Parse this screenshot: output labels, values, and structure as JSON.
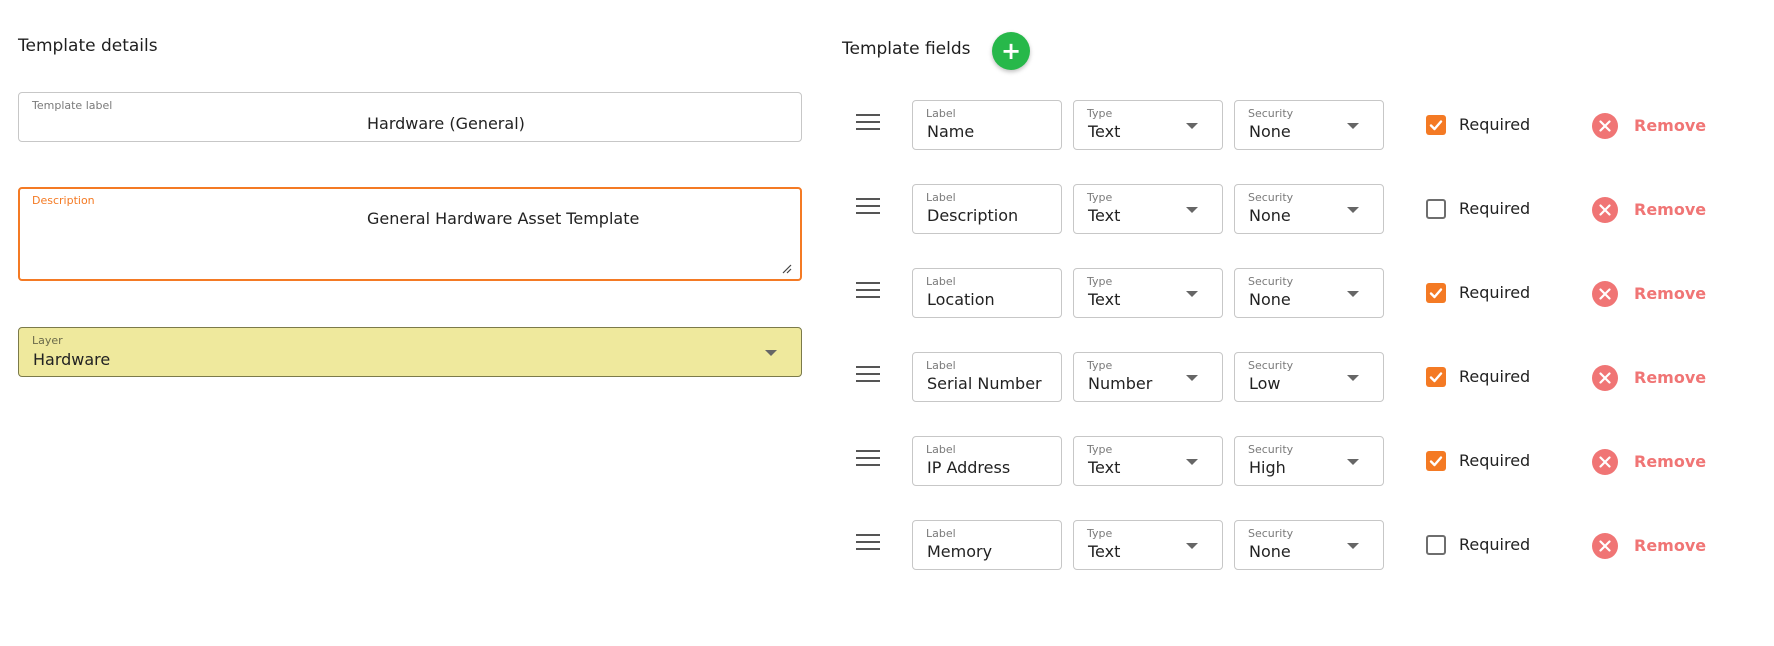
{
  "template_details": {
    "title": "Template details",
    "label_field": {
      "label": "Template label",
      "value": "Hardware (General)"
    },
    "description_field": {
      "label": "Description",
      "value": "General Hardware Asset Template"
    },
    "layer_field": {
      "label": "Layer",
      "value": "Hardware"
    }
  },
  "template_fields": {
    "title": "Template fields",
    "add_icon": "plus-icon",
    "column_labels": {
      "label": "Label",
      "type": "Type",
      "security": "Security"
    },
    "required_text": "Required",
    "remove_text": "Remove",
    "rows": [
      {
        "label": "Name",
        "type": "Text",
        "security": "None",
        "required": true
      },
      {
        "label": "Description",
        "type": "Text",
        "security": "None",
        "required": false
      },
      {
        "label": "Location",
        "type": "Text",
        "security": "None",
        "required": true
      },
      {
        "label": "Serial Number",
        "type": "Number",
        "security": "Low",
        "required": true
      },
      {
        "label": "IP Address",
        "type": "Text",
        "security": "High",
        "required": true
      },
      {
        "label": "Memory",
        "type": "Text",
        "security": "None",
        "required": false
      }
    ]
  },
  "colors": {
    "accent": "#f47a24",
    "add_button": "#27b84a",
    "remove": "#f07575",
    "layer_bg": "#efe99d"
  }
}
